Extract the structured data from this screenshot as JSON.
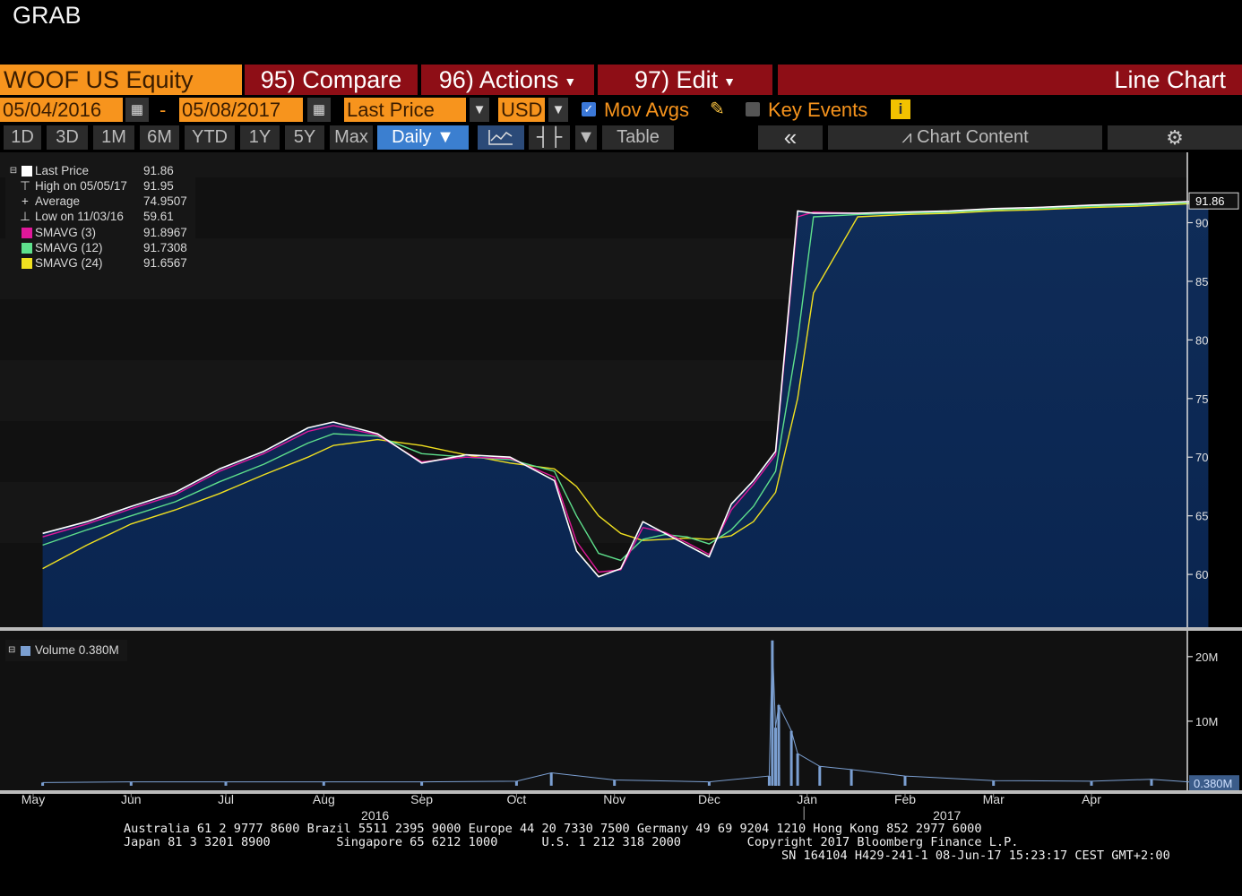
{
  "window": {
    "title": "GRAB"
  },
  "toolbar": {
    "security": "WOOF US Equity",
    "compare": "95) Compare",
    "actions": "96) Actions",
    "edit": "97) Edit",
    "chart_type": "Line Chart",
    "start_date": "05/04/2016",
    "date_separator": "-",
    "end_date": "05/08/2017",
    "field": "Last Price",
    "currency": "USD",
    "mov_avgs_label": "Mov Avgs",
    "mov_avgs_checked": true,
    "key_events_label": "Key Events",
    "key_events_checked": false,
    "info_icon": "i",
    "periods": [
      "1D",
      "3D",
      "1M",
      "6M",
      "YTD",
      "1Y",
      "5Y",
      "Max"
    ],
    "frequency": "Daily",
    "table_label": "Table",
    "chart_content_label": "Chart Content"
  },
  "legend": {
    "rows": [
      {
        "label": "Last Price",
        "value": "91.86",
        "color": "#ffffff"
      },
      {
        "label": "High on 05/05/17",
        "value": "91.95"
      },
      {
        "label": "Average",
        "value": "74.9507"
      },
      {
        "label": "Low on 11/03/16",
        "value": "59.61"
      },
      {
        "label": "SMAVG (3)",
        "value": "91.8967",
        "color": "#e0189a"
      },
      {
        "label": "SMAVG (12)",
        "value": "91.7308",
        "color": "#5ee08c"
      },
      {
        "label": "SMAVG (24)",
        "value": "91.6567",
        "color": "#f0e020"
      }
    ],
    "volume_label": "Volume 0.380M"
  },
  "chart_data": [
    {
      "type": "line",
      "title": "",
      "x": [
        "2016-05-04",
        "2016-05-18",
        "2016-06-01",
        "2016-06-15",
        "2016-06-29",
        "2016-07-13",
        "2016-07-27",
        "2016-08-04",
        "2016-08-18",
        "2016-09-01",
        "2016-09-15",
        "2016-09-29",
        "2016-10-13",
        "2016-10-20",
        "2016-10-27",
        "2016-11-03",
        "2016-11-10",
        "2016-11-17",
        "2016-11-24",
        "2016-12-01",
        "2016-12-08",
        "2016-12-15",
        "2016-12-22",
        "2016-12-29",
        "2017-01-03",
        "2017-01-17",
        "2017-02-01",
        "2017-02-15",
        "2017-03-01",
        "2017-03-15",
        "2017-04-01",
        "2017-04-15",
        "2017-05-01",
        "2017-05-08"
      ],
      "series": [
        {
          "name": "Last Price",
          "color": "#ffffff",
          "values": [
            63.5,
            64.5,
            65.8,
            67.0,
            69.0,
            70.5,
            72.5,
            73.0,
            72.0,
            69.5,
            70.2,
            70.0,
            68.0,
            62.0,
            59.8,
            60.5,
            64.5,
            63.5,
            62.5,
            61.5,
            66.0,
            68.0,
            70.5,
            91.0,
            90.8,
            90.8,
            90.9,
            91.0,
            91.2,
            91.3,
            91.5,
            91.6,
            91.8,
            91.86
          ]
        },
        {
          "name": "SMAVG (3)",
          "color": "#e0189a",
          "values": [
            63.2,
            64.3,
            65.6,
            66.8,
            68.8,
            70.3,
            72.2,
            72.7,
            71.9,
            69.6,
            70.0,
            69.9,
            68.3,
            62.8,
            60.2,
            60.4,
            64.0,
            63.6,
            62.7,
            61.7,
            65.5,
            67.7,
            70.2,
            90.5,
            90.9,
            90.8,
            90.9,
            91.0,
            91.2,
            91.3,
            91.5,
            91.6,
            91.8,
            91.8967
          ]
        },
        {
          "name": "SMAVG (12)",
          "color": "#5ee08c",
          "values": [
            62.5,
            63.8,
            65.0,
            66.2,
            67.9,
            69.4,
            71.2,
            72.0,
            71.8,
            70.3,
            70.0,
            69.8,
            68.8,
            65.0,
            61.8,
            61.2,
            63.0,
            63.4,
            63.2,
            62.6,
            63.8,
            65.8,
            68.8,
            80.0,
            90.5,
            90.7,
            90.8,
            90.9,
            91.1,
            91.2,
            91.4,
            91.5,
            91.7,
            91.7308
          ]
        },
        {
          "name": "SMAVG (24)",
          "color": "#f0e020",
          "values": [
            60.5,
            62.5,
            64.3,
            65.5,
            66.9,
            68.5,
            70.0,
            71.0,
            71.5,
            71.0,
            70.2,
            69.5,
            69.0,
            67.5,
            65.0,
            63.5,
            62.9,
            63.0,
            63.1,
            63.0,
            63.3,
            64.5,
            67.0,
            75.0,
            84.0,
            90.5,
            90.7,
            90.8,
            91.0,
            91.1,
            91.3,
            91.4,
            91.6,
            91.6567
          ]
        }
      ],
      "y_ticks": [
        "60",
        "65",
        "70",
        "75",
        "80",
        "85",
        "90"
      ],
      "ylim": [
        55.5,
        96
      ],
      "last_value_label": "91.86",
      "grid": false
    },
    {
      "type": "bar",
      "title": "",
      "x": [
        "2016-05-04",
        "2016-06-01",
        "2016-07-01",
        "2016-08-01",
        "2016-09-01",
        "2016-10-01",
        "2016-10-12",
        "2016-11-01",
        "2016-12-01",
        "2016-12-20",
        "2016-12-21",
        "2016-12-22",
        "2016-12-23",
        "2016-12-27",
        "2016-12-29",
        "2017-01-05",
        "2017-01-15",
        "2017-02-01",
        "2017-03-01",
        "2017-04-01",
        "2017-04-20",
        "2017-05-08"
      ],
      "series": [
        {
          "name": "Volume",
          "color": "#7b9fd1",
          "values": [
            0.5,
            0.6,
            0.6,
            0.6,
            0.6,
            0.7,
            2.0,
            0.9,
            0.6,
            1.5,
            22.5,
            9.0,
            12.5,
            8.5,
            5.0,
            3.0,
            2.5,
            1.5,
            0.8,
            0.7,
            1.0,
            0.38
          ]
        }
      ],
      "unit": "M",
      "y_ticks": [
        "10M",
        "20M"
      ],
      "ylim": [
        -0.7,
        24
      ],
      "last_value_label": "0.380M"
    }
  ],
  "x_axis": {
    "months": [
      {
        "label": "May",
        "date": "2016-05-01"
      },
      {
        "label": "Jun",
        "date": "2016-06-01"
      },
      {
        "label": "Jul",
        "date": "2016-07-01"
      },
      {
        "label": "Aug",
        "date": "2016-08-01"
      },
      {
        "label": "Sep",
        "date": "2016-09-01"
      },
      {
        "label": "Oct",
        "date": "2016-10-01"
      },
      {
        "label": "Nov",
        "date": "2016-11-01"
      },
      {
        "label": "Dec",
        "date": "2016-12-01"
      },
      {
        "label": "Jan",
        "date": "2017-01-01"
      },
      {
        "label": "Feb",
        "date": "2017-02-01"
      },
      {
        "label": "Mar",
        "date": "2017-03-01"
      },
      {
        "label": "Apr",
        "date": "2017-04-01"
      }
    ],
    "years": [
      {
        "label": "2016",
        "date": "2016-09-01"
      },
      {
        "label": "2017",
        "date": "2017-03-01"
      }
    ]
  },
  "footer": {
    "line1": "Australia 61 2 9777 8600 Brazil 5511 2395 9000 Europe 44 20 7330 7500 Germany 49 69 9204 1210 Hong Kong 852 2977 6000",
    "line2": "Japan 81 3 3201 8900         Singapore 65 6212 1000      U.S. 1 212 318 2000         Copyright 2017 Bloomberg Finance L.P.",
    "line3": "SN 164104 H429-241-1 08-Jun-17 15:23:17 CEST GMT+2:00"
  }
}
